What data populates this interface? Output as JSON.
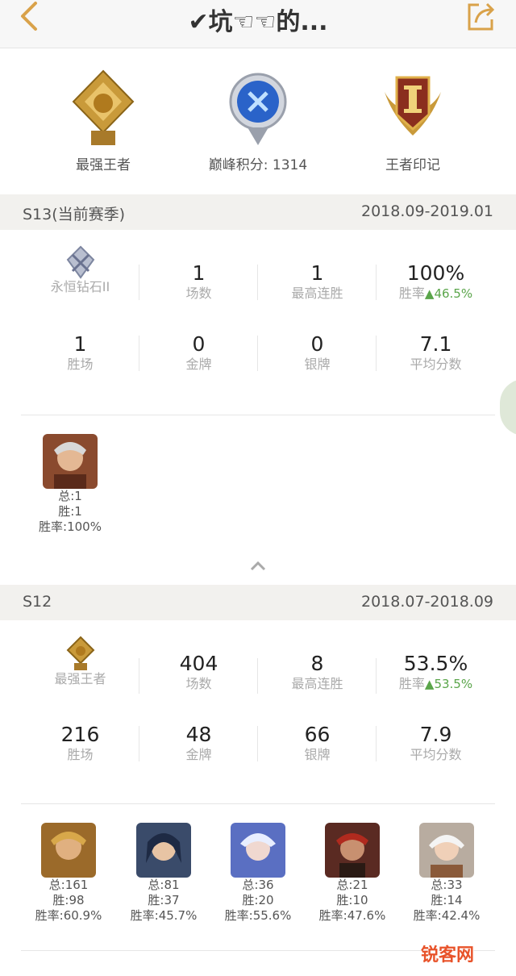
{
  "header": {
    "title": "✔坑☜☜的..."
  },
  "honors": [
    {
      "label": "最强王者"
    },
    {
      "label": "巅峰积分: 1314"
    },
    {
      "label": "王者印记"
    }
  ],
  "seasons": [
    {
      "name": "S13(当前赛季)",
      "dates": "2018.09-2019.01",
      "rank_label": "永恒钻石II",
      "games": "1",
      "games_label": "场数",
      "streak": "1",
      "streak_label": "最高连胜",
      "winrate": "100%",
      "winrate_label": "胜率",
      "winrate_delta": "46.5%",
      "wins": "1",
      "wins_label": "胜场",
      "gold": "0",
      "gold_label": "金牌",
      "silver": "0",
      "silver_label": "银牌",
      "avg": "7.1",
      "avg_label": "平均分数",
      "heroes": [
        {
          "total": "总:1",
          "wins": "胜:1",
          "rate": "胜率:100%",
          "color": "#8a4a2e"
        }
      ]
    },
    {
      "name": "S12",
      "dates": "2018.07-2018.09",
      "rank_label": "最强王者",
      "games": "404",
      "games_label": "场数",
      "streak": "8",
      "streak_label": "最高连胜",
      "winrate": "53.5%",
      "winrate_label": "胜率",
      "winrate_delta": "53.5%",
      "wins": "216",
      "wins_label": "胜场",
      "gold": "48",
      "gold_label": "金牌",
      "silver": "66",
      "silver_label": "银牌",
      "avg": "7.9",
      "avg_label": "平均分数",
      "heroes": [
        {
          "total": "总:161",
          "wins": "胜:98",
          "rate": "胜率:60.9%",
          "color": "#9b6a2a"
        },
        {
          "total": "总:81",
          "wins": "胜:37",
          "rate": "胜率:45.7%",
          "color": "#3a4b6a"
        },
        {
          "total": "总:36",
          "wins": "胜:20",
          "rate": "胜率:55.6%",
          "color": "#5a6fc2"
        },
        {
          "total": "总:21",
          "wins": "胜:10",
          "rate": "胜率:47.6%",
          "color": "#5a2a22"
        },
        {
          "total": "总:33",
          "wins": "胜:14",
          "rate": "胜率:42.4%",
          "color": "#b8aca0"
        }
      ]
    }
  ],
  "watermark": {
    "text": "锐客网"
  },
  "colors": {
    "accent": "#d9a24a",
    "positive": "#5aa54a",
    "season_bar": "#f2f1ee"
  }
}
